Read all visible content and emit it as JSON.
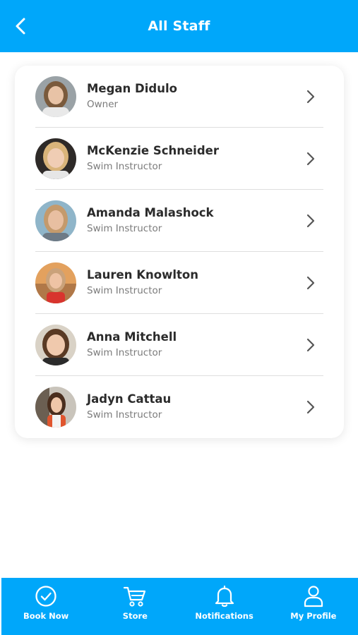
{
  "header": {
    "title": "All Staff",
    "back_icon": "chevron-left-icon",
    "background": "#00a7fa"
  },
  "staff": [
    {
      "name": "Megan Didulo",
      "role": "Owner"
    },
    {
      "name": "McKenzie Schneider",
      "role": "Swim Instructor"
    },
    {
      "name": "Amanda Malashock",
      "role": "Swim Instructor"
    },
    {
      "name": "Lauren Knowlton",
      "role": "Swim Instructor"
    },
    {
      "name": "Anna Mitchell",
      "role": "Swim Instructor"
    },
    {
      "name": "Jadyn Cattau",
      "role": "Swim Instructor"
    }
  ],
  "tabbar": {
    "items": [
      {
        "label": "Book Now",
        "icon": "check-circle-icon"
      },
      {
        "label": "Store",
        "icon": "cart-icon"
      },
      {
        "label": "Notifications",
        "icon": "bell-icon"
      },
      {
        "label": "My Profile",
        "icon": "user-icon"
      }
    ]
  },
  "colors": {
    "accent": "#00a7fa",
    "name_text": "#2b2b2b",
    "role_text": "#7b7b7b"
  }
}
